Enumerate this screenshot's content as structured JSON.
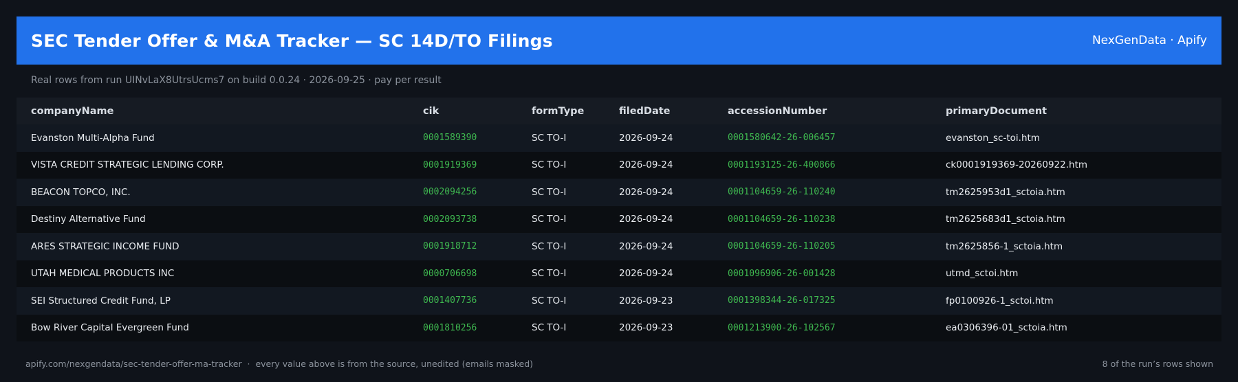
{
  "header": {
    "title": "SEC Tender Offer & M&A Tracker — SC 14D/TO Filings",
    "brand": "NexGenData · Apify",
    "background_color": "#2272eb"
  },
  "subtitle": "Real rows from run UINvLaX8UtrsUcms7 on build 0.0.24 · 2026-09-25 · pay per result",
  "table": {
    "columns": [
      "companyName",
      "cik",
      "formType",
      "filedDate",
      "accessionNumber",
      "primaryDocument"
    ],
    "rows": [
      [
        "Evanston Multi-Alpha Fund",
        "0001589390",
        "SC TO-I",
        "2026-09-24",
        "0001580642-26-006457",
        "evanston_sc-toi.htm"
      ],
      [
        "VISTA CREDIT STRATEGIC LENDING CORP.",
        "0001919369",
        "SC TO-I",
        "2026-09-24",
        "0001193125-26-400866",
        "ck0001919369-20260922.htm"
      ],
      [
        "BEACON TOPCO, INC.",
        "0002094256",
        "SC TO-I",
        "2026-09-24",
        "0001104659-26-110240",
        "tm2625953d1_sctoia.htm"
      ],
      [
        "Destiny Alternative Fund",
        "0002093738",
        "SC TO-I",
        "2026-09-24",
        "0001104659-26-110238",
        "tm2625683d1_sctoia.htm"
      ],
      [
        "ARES STRATEGIC INCOME FUND",
        "0001918712",
        "SC TO-I",
        "2026-09-24",
        "0001104659-26-110205",
        "tm2625856-1_sctoia.htm"
      ],
      [
        "UTAH MEDICAL PRODUCTS INC",
        "0000706698",
        "SC TO-I",
        "2026-09-24",
        "0001096906-26-001428",
        "utmd_sctoi.htm"
      ],
      [
        "SEI Structured Credit Fund, LP",
        "0001407736",
        "SC TO-I",
        "2026-09-23",
        "0001398344-26-017325",
        "fp0100926-1_sctoi.htm"
      ],
      [
        "Bow River Capital Evergreen Fund",
        "0001810256",
        "SC TO-I",
        "2026-09-23",
        "0001213900-26-102567",
        "ea0306396-01_sctoia.htm"
      ]
    ],
    "accent_color": "#3fb950"
  },
  "footer": {
    "left": "apify.com/nexgendata/sec-tender-offer-ma-tracker  ·  every value above is from the source, unedited (emails masked)",
    "right": "8 of the run’s rows shown"
  }
}
